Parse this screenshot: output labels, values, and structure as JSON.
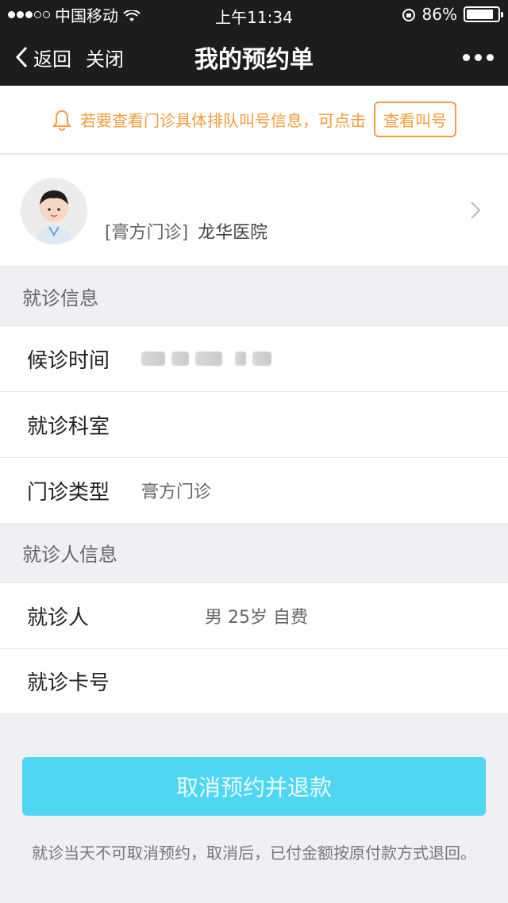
{
  "status_bar": {
    "carrier": "中国移动",
    "time": "上午11:34",
    "battery_percent": "86%",
    "battery_level": 0.86
  },
  "nav": {
    "back_label": "返回",
    "close_label": "关闭",
    "title": "我的预约单"
  },
  "notice": {
    "text": "若要查看门诊具体排队叫号信息，可点击",
    "button_label": "查看叫号"
  },
  "doctor": {
    "clinic_type": "[膏方门诊]",
    "hospital": "龙华医院"
  },
  "visit_info": {
    "section_title": "就诊信息",
    "rows": [
      {
        "label": "候诊时间",
        "value": ""
      },
      {
        "label": "就诊科室",
        "value": ""
      },
      {
        "label": "门诊类型",
        "value": "膏方门诊"
      }
    ]
  },
  "patient_info": {
    "section_title": "就诊人信息",
    "rows": [
      {
        "label": "就诊人",
        "value": "男 25岁 自费"
      },
      {
        "label": "就诊卡号",
        "value": ""
      }
    ]
  },
  "actions": {
    "cancel_button": "取消预约并退款",
    "tip": "就诊当天不可取消预约，取消后，已付金额按原付款方式退回。"
  },
  "colors": {
    "accent": "#4fd6f2",
    "notice": "#f39c3b",
    "header_bg": "#1d1d1f"
  }
}
